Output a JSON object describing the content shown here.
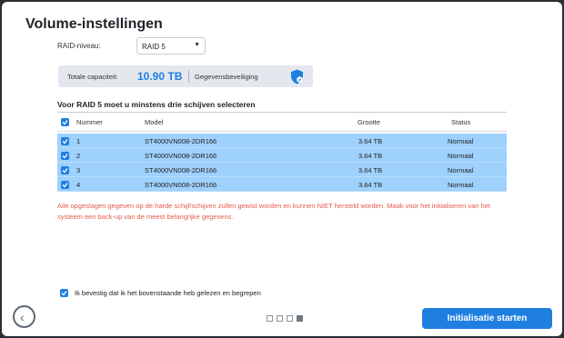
{
  "dialog": {
    "title": "Volume-instellingen"
  },
  "raid": {
    "label": "RAID-niveau:",
    "selected": "RAID 5"
  },
  "capacity": {
    "label": "Totale capaciteit:",
    "value": "10.90 TB",
    "protection_label": "Gegevensbeveiliging"
  },
  "section": {
    "heading": "Voor RAID 5 moet u minstens drie schijven selecteren"
  },
  "table": {
    "headers": {
      "number": "Nummer",
      "model": "Model",
      "size": "Grootte",
      "status": "Status"
    },
    "rows": [
      {
        "number": "1",
        "model": "ST4000VN008-2DR166",
        "size": "3.64 TB",
        "status": "Normaal"
      },
      {
        "number": "2",
        "model": "ST4000VN008-2DR166",
        "size": "3.64 TB",
        "status": "Normaal"
      },
      {
        "number": "3",
        "model": "ST4000VN008-2DR166",
        "size": "3.64 TB",
        "status": "Normaal"
      },
      {
        "number": "4",
        "model": "ST4000VN008-2DR166",
        "size": "3.64 TB",
        "status": "Normaal"
      }
    ]
  },
  "warning": {
    "line1": "Alle opgeslagen gegeven op de harde schijf/schijven zullen gewist worden en kunnen NIET hersteld worden. Maak voor het initialiseren van het",
    "line2": "systeem een back-up van de meest belangrijke gegevens."
  },
  "confirm": {
    "label": "Ik bevestig dat ik het bovenstaande heb gelezen en begrepen",
    "checked": true
  },
  "footer": {
    "start_label": "Initialisatie starten",
    "back_icon": "back-arrow-icon",
    "page_count": 4,
    "active_page": 4
  },
  "colors": {
    "accent": "#1f7fe0",
    "selected_row": "#9ed1fb",
    "warning": "#e45a4d",
    "capacity": "#1e7fe0"
  }
}
